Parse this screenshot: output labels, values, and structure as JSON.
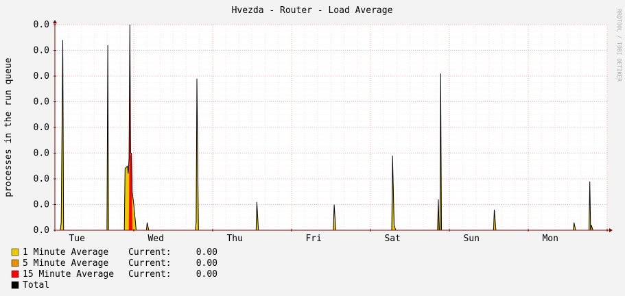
{
  "chart_data": {
    "type": "area",
    "title": "Hvezda - Router - Load Average",
    "ylabel": "processes in the run queue",
    "watermark": "RRDTOOL / TOBI OETIKER",
    "y_tick_labels": [
      "0.0",
      "0.0",
      "0.0",
      "0.0",
      "0.0",
      "0.0",
      "0.0",
      "0.0",
      "0.0"
    ],
    "ylim": [
      0,
      8
    ],
    "x_tick_labels": [
      "Tue",
      "Wed",
      "Thu",
      "Fri",
      "Sat",
      "Sun",
      "Mon"
    ],
    "xlim": [
      0,
      7
    ],
    "grid": true,
    "legend_position": "bottom-left",
    "colors": {
      "background": "#f3f3f3",
      "plot_background": "#ffffff",
      "grid": "#ff9999",
      "axis": "#800000",
      "one_minute": "#eacc00",
      "five_minute": "#ea8f00",
      "fifteen_minute": "#ff0000",
      "total": "#000000",
      "text": "#000000",
      "watermark": "#aaaaaa"
    },
    "series": [
      {
        "name": "1 Minute Average",
        "current_label": "Current:",
        "current": "0.00",
        "color": "#eacc00",
        "points": [
          [
            0.07,
            0
          ],
          [
            0.08,
            0.3
          ],
          [
            0.1,
            7.4
          ],
          [
            0.11,
            0
          ],
          [
            0.66,
            0
          ],
          [
            0.67,
            7.2
          ],
          [
            0.68,
            0
          ],
          [
            0.88,
            0
          ],
          [
            0.89,
            2.4
          ],
          [
            0.92,
            2.5
          ],
          [
            0.93,
            2.2
          ],
          [
            0.94,
            2.8
          ],
          [
            0.95,
            1.4
          ],
          [
            0.97,
            1.3
          ],
          [
            0.98,
            1.5
          ],
          [
            1.0,
            1.0
          ],
          [
            1.03,
            0
          ],
          [
            1.16,
            0
          ],
          [
            1.17,
            0.3
          ],
          [
            1.19,
            0
          ],
          [
            1.78,
            0
          ],
          [
            1.79,
            0.3
          ],
          [
            1.8,
            5.9
          ],
          [
            1.81,
            3.0
          ],
          [
            1.82,
            0
          ],
          [
            2.55,
            0
          ],
          [
            2.56,
            1.1
          ],
          [
            2.58,
            0
          ],
          [
            3.53,
            0
          ],
          [
            3.54,
            1.0
          ],
          [
            3.56,
            0
          ],
          [
            4.27,
            0
          ],
          [
            4.28,
            2.9
          ],
          [
            4.3,
            0.2
          ],
          [
            4.32,
            0
          ],
          [
            4.85,
            0
          ],
          [
            4.86,
            1.2
          ],
          [
            4.87,
            0
          ],
          [
            4.88,
            0
          ],
          [
            4.89,
            6.1
          ],
          [
            4.9,
            0
          ],
          [
            5.56,
            0
          ],
          [
            5.57,
            0.8
          ],
          [
            5.59,
            0
          ],
          [
            6.57,
            0
          ],
          [
            6.58,
            0.3
          ],
          [
            6.6,
            0
          ],
          [
            6.77,
            0
          ],
          [
            6.78,
            1.9
          ],
          [
            6.79,
            0
          ],
          [
            6.8,
            0.2
          ],
          [
            6.82,
            0
          ]
        ]
      },
      {
        "name": "5 Minute Average",
        "current_label": "Current:",
        "current": "0.00",
        "color": "#ea8f00",
        "points": [
          [
            0.93,
            0
          ],
          [
            0.94,
            1.0
          ],
          [
            0.96,
            2.6
          ],
          [
            0.97,
            2.2
          ],
          [
            0.99,
            0
          ],
          [
            1.9,
            0
          ]
        ]
      },
      {
        "name": "15 Minute Average",
        "current_label": "Current:",
        "current": "0.00",
        "color": "#ff0000",
        "points": [
          [
            0.94,
            0
          ],
          [
            0.95,
            7.4
          ],
          [
            0.96,
            3.0
          ],
          [
            0.97,
            2.8
          ],
          [
            0.98,
            0
          ]
        ]
      },
      {
        "name": "Total",
        "color": "#000000",
        "points": [
          [
            0.07,
            0
          ],
          [
            0.08,
            0.3
          ],
          [
            0.1,
            7.4
          ],
          [
            0.11,
            0
          ],
          [
            0.66,
            0
          ],
          [
            0.67,
            7.2
          ],
          [
            0.68,
            0
          ],
          [
            0.88,
            0
          ],
          [
            0.89,
            2.4
          ],
          [
            0.92,
            2.5
          ],
          [
            0.93,
            2.2
          ],
          [
            0.94,
            2.8
          ],
          [
            0.95,
            8.0
          ],
          [
            0.96,
            3.0
          ],
          [
            0.97,
            3.0
          ],
          [
            0.98,
            1.5
          ],
          [
            1.0,
            1.0
          ],
          [
            1.03,
            0
          ],
          [
            1.16,
            0
          ],
          [
            1.17,
            0.3
          ],
          [
            1.19,
            0
          ],
          [
            1.78,
            0
          ],
          [
            1.79,
            0.3
          ],
          [
            1.8,
            5.9
          ],
          [
            1.81,
            3.0
          ],
          [
            1.82,
            0
          ],
          [
            2.55,
            0
          ],
          [
            2.56,
            1.1
          ],
          [
            2.58,
            0
          ],
          [
            3.53,
            0
          ],
          [
            3.54,
            1.0
          ],
          [
            3.56,
            0
          ],
          [
            4.27,
            0
          ],
          [
            4.28,
            2.9
          ],
          [
            4.3,
            0.2
          ],
          [
            4.32,
            0
          ],
          [
            4.85,
            0
          ],
          [
            4.86,
            1.2
          ],
          [
            4.87,
            0
          ],
          [
            4.88,
            0
          ],
          [
            4.89,
            6.1
          ],
          [
            4.9,
            0
          ],
          [
            5.56,
            0
          ],
          [
            5.57,
            0.8
          ],
          [
            5.59,
            0
          ],
          [
            6.57,
            0
          ],
          [
            6.58,
            0.3
          ],
          [
            6.6,
            0
          ],
          [
            6.77,
            0
          ],
          [
            6.78,
            1.9
          ],
          [
            6.79,
            0
          ],
          [
            6.8,
            0.2
          ],
          [
            6.82,
            0
          ]
        ]
      }
    ]
  }
}
